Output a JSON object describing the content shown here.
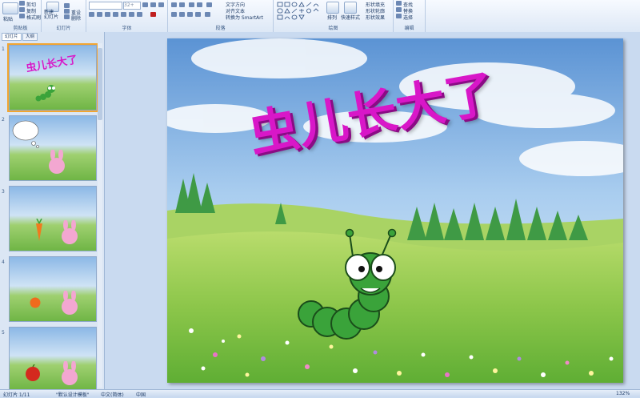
{
  "ribbon": {
    "clipboard": {
      "label": "剪贴板",
      "paste": "粘贴",
      "cut": "剪切",
      "copy": "复制",
      "format_painter": "格式刷"
    },
    "slides": {
      "label": "幻灯片",
      "new_slide": "新建\n幻灯片",
      "reset": "重设",
      "delete": "删除"
    },
    "font": {
      "label": "字体",
      "size": "32+"
    },
    "paragraph": {
      "label": "段落",
      "text_direction": "文字方向",
      "align_text": "对齐文本",
      "smartart": "转换为 SmartArt"
    },
    "drawing": {
      "label": "绘图",
      "arrange": "排列",
      "quick_styles": "快速样式",
      "shape_fill": "形状填充",
      "shape_outline": "形状轮廓",
      "shape_effects": "形状效果"
    },
    "editing": {
      "label": "编辑",
      "find": "查找",
      "replace": "替换",
      "select": "选择"
    }
  },
  "panel": {
    "tabs": [
      "幻灯片",
      "大纲"
    ],
    "thumbnails": [
      {
        "num": "1",
        "title": "虫儿长大了"
      },
      {
        "num": "2"
      },
      {
        "num": "3"
      },
      {
        "num": "4"
      },
      {
        "num": "5"
      }
    ]
  },
  "slide": {
    "title": "虫儿长大了"
  },
  "status": {
    "slide_info": "幻灯片 1/11",
    "theme": "\"默认设计模板\"",
    "language": "中文(简体)",
    "region": "中国",
    "zoom": "132%"
  },
  "colors": {
    "title": "#d817c8",
    "ribbon_bg": "#dde8f6",
    "caterpillar": "#3aa33a"
  }
}
